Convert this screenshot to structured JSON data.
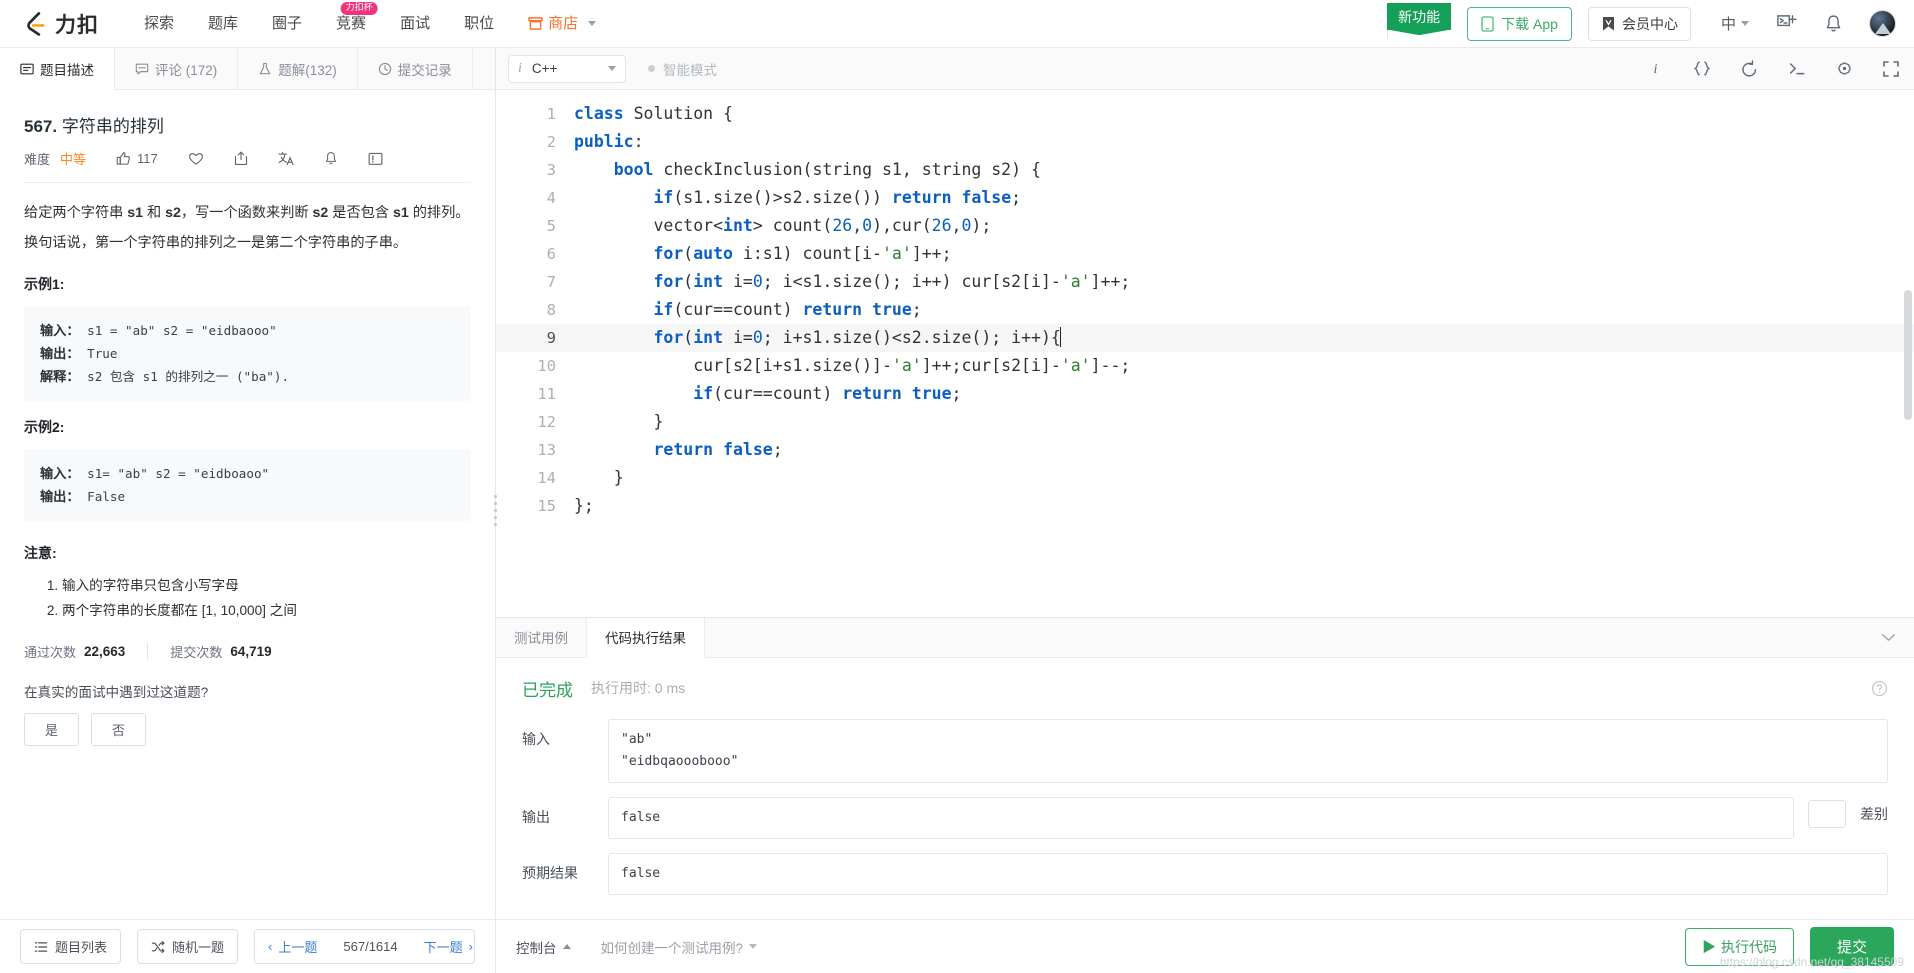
{
  "navbar": {
    "brand": "力扣",
    "links": [
      {
        "label": "探索",
        "badge": null
      },
      {
        "label": "题库",
        "badge": null
      },
      {
        "label": "圈子",
        "badge": null
      },
      {
        "label": "竞赛",
        "badge": "力扣杯"
      },
      {
        "label": "面试",
        "badge": null
      },
      {
        "label": "职位",
        "badge": null
      }
    ],
    "store_label": "商店",
    "ribbon_label": "新功能",
    "download_label": "下载 App",
    "vip_label": "会员中心",
    "lang_label": "中",
    "icons": {
      "terminal": "terminal-plus-icon",
      "bell": "bell-icon",
      "avatar": "avatar"
    },
    "colors": {
      "brand_orange": "#ff8a1e",
      "green": "#2aa75b",
      "badge_pink": "#f0347f"
    }
  },
  "left": {
    "tabs": [
      {
        "label": "题目描述",
        "icon": "description-icon",
        "active": true
      },
      {
        "label": "评论 (172)",
        "icon": "comment-icon",
        "active": false
      },
      {
        "label": "题解(132)",
        "icon": "flask-icon",
        "active": false
      },
      {
        "label": "提交记录",
        "icon": "clock-icon",
        "active": false
      }
    ],
    "question": {
      "number": "567.",
      "title": "字符串的排列",
      "difficulty_label": "难度",
      "difficulty": "中等",
      "likes": "117",
      "paragraphs": [
        "给定两个字符串 s1 和 s2，写一个函数来判断 s2 是否包含 s1 的排列。",
        "换句话说，第一个字符串的排列之一是第二个字符串的子串。"
      ],
      "examples": [
        {
          "heading": "示例1:",
          "lines": [
            {
              "key": "输入：",
              "value": " s1 = \"ab\" s2 = \"eidbaooo\""
            },
            {
              "key": "输出：",
              "value": " True"
            },
            {
              "key": "解释：",
              "value": " s2 包含 s1 的排列之一 (\"ba\")."
            }
          ]
        },
        {
          "heading": "示例2:",
          "lines": [
            {
              "key": "输入：",
              "value": " s1= \"ab\" s2 = \"eidboaoo\""
            },
            {
              "key": "输出：",
              "value": " False"
            }
          ]
        }
      ],
      "note_heading": "注意:",
      "notes": [
        "输入的字符串只包含小写字母",
        "两个字符串的长度都在 [1, 10,000] 之间"
      ],
      "stats": {
        "accepted_label": "通过次数",
        "accepted_value": "22,663",
        "submitted_label": "提交次数",
        "submitted_value": "64,719"
      },
      "interview_question": "在真实的面试中遇到过这道题?",
      "yes_label": "是",
      "no_label": "否"
    },
    "footer": {
      "list_label": "题目列表",
      "random_label": "随机一题",
      "prev_label": "上一题",
      "counter": "567/1614",
      "next_label": "下一题"
    }
  },
  "editor": {
    "language": "C++",
    "smart_mode_label": "智能模式",
    "toolbar_icons": [
      "info-icon",
      "braces-icon",
      "reset-icon",
      "console-icon",
      "settings-icon",
      "fullscreen-icon"
    ],
    "lines": [
      {
        "n": "1",
        "highlight": false,
        "tokens": [
          {
            "t": "class ",
            "c": "kw"
          },
          {
            "t": "Solution {",
            "c": ""
          }
        ]
      },
      {
        "n": "2",
        "highlight": false,
        "tokens": [
          {
            "t": "public",
            "c": "kw"
          },
          {
            "t": ":",
            "c": ""
          }
        ]
      },
      {
        "n": "3",
        "highlight": false,
        "tokens": [
          {
            "t": "    ",
            "c": ""
          },
          {
            "t": "bool",
            "c": "kw"
          },
          {
            "t": " checkInclusion(string s1, string s2) {",
            "c": ""
          }
        ]
      },
      {
        "n": "4",
        "highlight": false,
        "tokens": [
          {
            "t": "        ",
            "c": ""
          },
          {
            "t": "if",
            "c": "kw"
          },
          {
            "t": "(s1.size()>s2.size()) ",
            "c": ""
          },
          {
            "t": "return",
            "c": "kw"
          },
          {
            "t": " ",
            "c": ""
          },
          {
            "t": "false",
            "c": "kw"
          },
          {
            "t": ";",
            "c": ""
          }
        ]
      },
      {
        "n": "5",
        "highlight": false,
        "tokens": [
          {
            "t": "        vector<",
            "c": ""
          },
          {
            "t": "int",
            "c": "kw"
          },
          {
            "t": "> count(",
            "c": ""
          },
          {
            "t": "26",
            "c": "num"
          },
          {
            "t": ",",
            "c": ""
          },
          {
            "t": "0",
            "c": "num"
          },
          {
            "t": "),cur(",
            "c": ""
          },
          {
            "t": "26",
            "c": "num"
          },
          {
            "t": ",",
            "c": ""
          },
          {
            "t": "0",
            "c": "num"
          },
          {
            "t": ");",
            "c": ""
          }
        ]
      },
      {
        "n": "6",
        "highlight": false,
        "tokens": [
          {
            "t": "        ",
            "c": ""
          },
          {
            "t": "for",
            "c": "kw"
          },
          {
            "t": "(",
            "c": ""
          },
          {
            "t": "auto",
            "c": "kw"
          },
          {
            "t": " i:s1) count[i-",
            "c": ""
          },
          {
            "t": "'a'",
            "c": "str"
          },
          {
            "t": "]++;",
            "c": ""
          }
        ]
      },
      {
        "n": "7",
        "highlight": false,
        "tokens": [
          {
            "t": "        ",
            "c": ""
          },
          {
            "t": "for",
            "c": "kw"
          },
          {
            "t": "(",
            "c": ""
          },
          {
            "t": "int",
            "c": "kw"
          },
          {
            "t": " i=",
            "c": ""
          },
          {
            "t": "0",
            "c": "num"
          },
          {
            "t": "; i<s1.size(); i++) cur[s2[i]-",
            "c": ""
          },
          {
            "t": "'a'",
            "c": "str"
          },
          {
            "t": "]++;",
            "c": ""
          }
        ]
      },
      {
        "n": "8",
        "highlight": false,
        "tokens": [
          {
            "t": "        ",
            "c": ""
          },
          {
            "t": "if",
            "c": "kw"
          },
          {
            "t": "(cur==count) ",
            "c": ""
          },
          {
            "t": "return",
            "c": "kw"
          },
          {
            "t": " ",
            "c": ""
          },
          {
            "t": "true",
            "c": "kw"
          },
          {
            "t": ";",
            "c": ""
          }
        ]
      },
      {
        "n": "9",
        "highlight": true,
        "tokens": [
          {
            "t": "        ",
            "c": ""
          },
          {
            "t": "for",
            "c": "kw"
          },
          {
            "t": "(",
            "c": ""
          },
          {
            "t": "int",
            "c": "kw"
          },
          {
            "t": " i=",
            "c": ""
          },
          {
            "t": "0",
            "c": "num"
          },
          {
            "t": "; i+s1.size()<s2.size(); i++){",
            "c": ""
          }
        ]
      },
      {
        "n": "10",
        "highlight": false,
        "tokens": [
          {
            "t": "            cur[s2[i+s1.size()]-",
            "c": ""
          },
          {
            "t": "'a'",
            "c": "str"
          },
          {
            "t": "]++;cur[s2[i]-",
            "c": ""
          },
          {
            "t": "'a'",
            "c": "str"
          },
          {
            "t": "]--;",
            "c": ""
          }
        ]
      },
      {
        "n": "11",
        "highlight": false,
        "tokens": [
          {
            "t": "            ",
            "c": ""
          },
          {
            "t": "if",
            "c": "kw"
          },
          {
            "t": "(cur==count) ",
            "c": ""
          },
          {
            "t": "return",
            "c": "kw"
          },
          {
            "t": " ",
            "c": ""
          },
          {
            "t": "true",
            "c": "kw"
          },
          {
            "t": ";",
            "c": ""
          }
        ]
      },
      {
        "n": "12",
        "highlight": false,
        "tokens": [
          {
            "t": "        }",
            "c": ""
          }
        ]
      },
      {
        "n": "13",
        "highlight": false,
        "tokens": [
          {
            "t": "        ",
            "c": ""
          },
          {
            "t": "return",
            "c": "kw"
          },
          {
            "t": " ",
            "c": ""
          },
          {
            "t": "false",
            "c": "kw"
          },
          {
            "t": ";",
            "c": ""
          }
        ]
      },
      {
        "n": "14",
        "highlight": false,
        "tokens": [
          {
            "t": "    }",
            "c": ""
          }
        ]
      },
      {
        "n": "15",
        "highlight": false,
        "tokens": [
          {
            "t": "};",
            "c": ""
          }
        ]
      }
    ]
  },
  "result": {
    "tabs": [
      {
        "label": "测试用例",
        "active": false
      },
      {
        "label": "代码执行结果",
        "active": true
      }
    ],
    "status": "已完成",
    "runtime": "执行用时: 0 ms",
    "rows": [
      {
        "label": "输入",
        "value": "\"ab\"\n\"eidbqaooobooo\"",
        "tall": true
      },
      {
        "label": "输出",
        "value": "false",
        "tall": false
      },
      {
        "label": "预期结果",
        "value": "false",
        "tall": false
      }
    ],
    "diff_label": "差别"
  },
  "right_footer": {
    "console_label": "控制台",
    "howto_label": "如何创建一个测试用例?",
    "run_label": "执行代码",
    "submit_label": "提交",
    "watermark": "https://blog.csdn.net/qq_38145509"
  }
}
